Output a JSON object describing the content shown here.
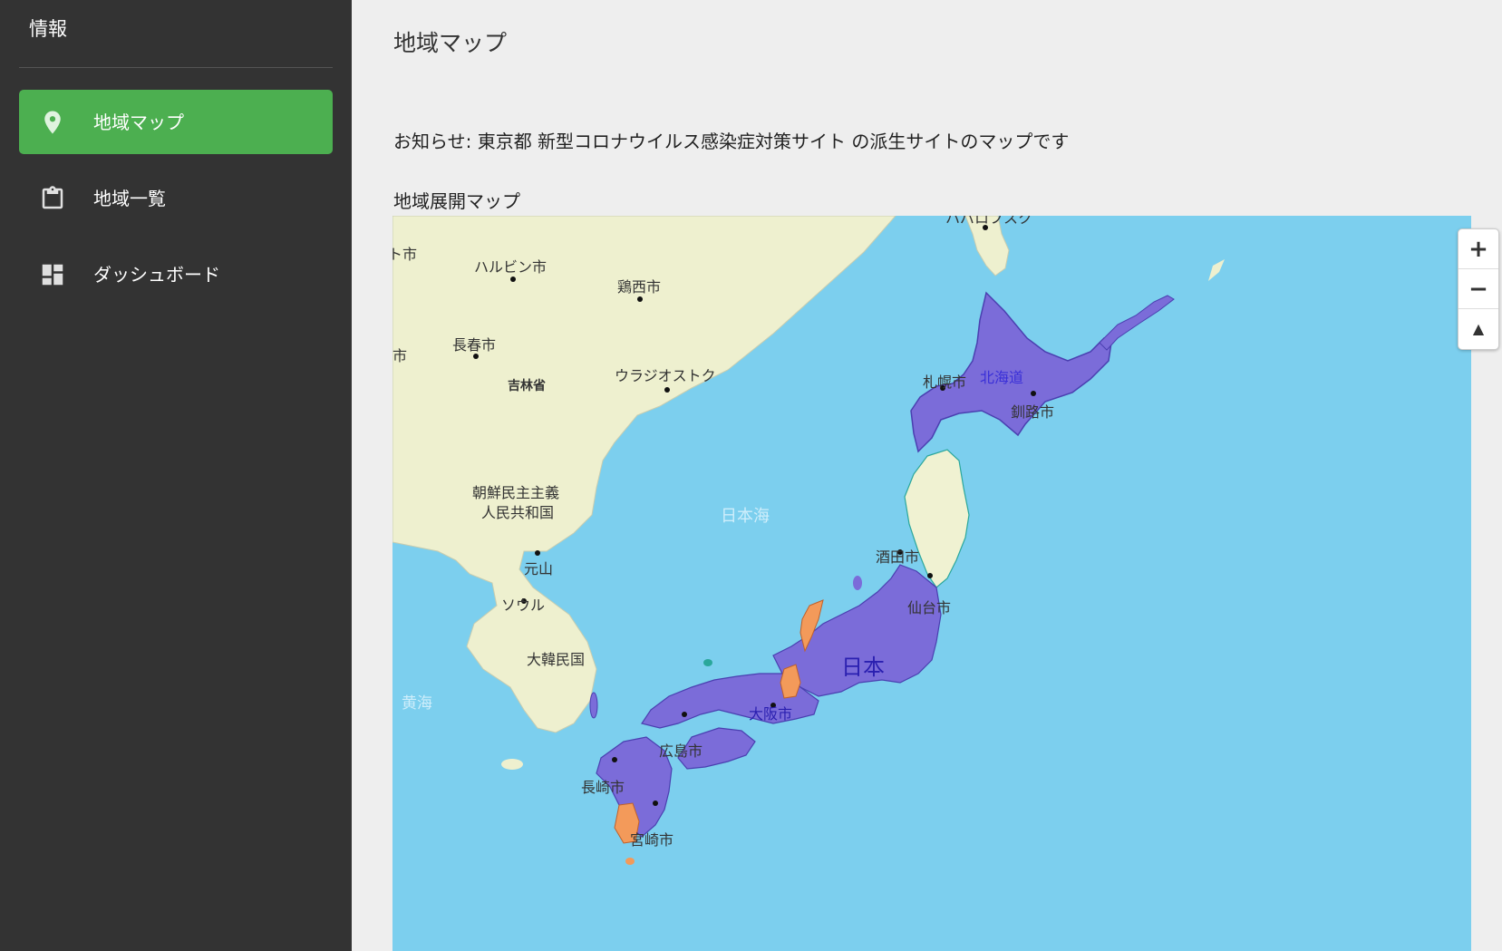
{
  "sidebar": {
    "title": "情報",
    "items": [
      {
        "label": "地域マップ",
        "icon": "map-pin-icon",
        "active": true
      },
      {
        "label": "地域一覧",
        "icon": "clipboard-icon",
        "active": false
      },
      {
        "label": "ダッシュボード",
        "icon": "dashboard-icon",
        "active": false
      }
    ]
  },
  "main": {
    "title": "地域マップ",
    "notice": "お知らせ: 東京都 新型コロナウイルス感染症対策サイト の派生サイトのマップです",
    "map_label": "地域展開マップ"
  },
  "map": {
    "colors": {
      "sea": "#7ccfee",
      "land": "#eef0cf",
      "purple": "#7b6cd9",
      "orange": "#f39a5a",
      "pale": "#f0f2d2"
    },
    "labels": {
      "harbin": "ハルビン市",
      "jixi": "鶏西市",
      "changchun": "長春市",
      "jilin": "吉林省",
      "vladivostok": "ウラジオストク",
      "north_korea_1": "朝鮮民主主義",
      "north_korea_2": "人民共和国",
      "wonsan": "元山",
      "seoul": "ソウル",
      "south_korea": "大韓民国",
      "yellow_sea": "黄海",
      "japan_sea": "日本海",
      "sapporo": "札幌市",
      "hokkaido": "北海道",
      "kushiro": "釧路市",
      "sakata": "酒田市",
      "sendai": "仙台市",
      "japan": "日本",
      "osaka": "大阪市",
      "hiroshima": "広島市",
      "nagasaki": "長崎市",
      "miyazaki": "宮崎市",
      "yuzhno": "ハバロフスク",
      "left_city_1": "ト市",
      "left_city_2": "市"
    },
    "controls": {
      "zoom_in": "+",
      "zoom_out": "−",
      "compass": "▲"
    }
  }
}
